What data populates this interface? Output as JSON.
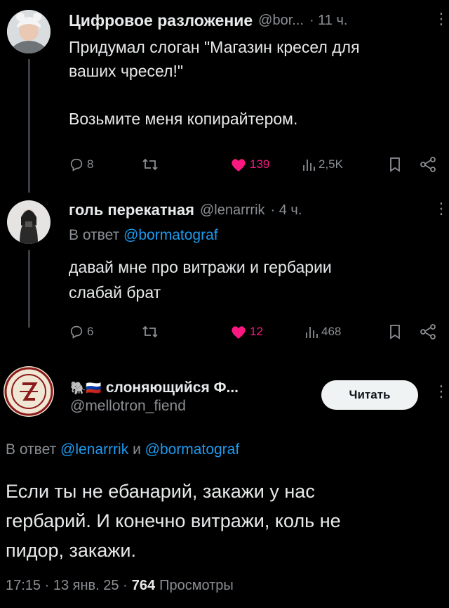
{
  "post1": {
    "display_name": "Цифровое разложение",
    "handle": "@bor...",
    "time": "· 11 ч.",
    "text_line1": "Придумал слоган \"Магазин кресел для",
    "text_line2": "ваших чресел!\"",
    "text_line3": "Возьмите меня копирайтером.",
    "replies": "8",
    "likes": "139",
    "views": "2,5K"
  },
  "post2": {
    "display_name": "голь перекатная",
    "handle": "@lenarrrik",
    "time": "· 4 ч.",
    "reply_prefix": "В ответ",
    "reply_to": "@bormatograf",
    "text_line1": "давай мне про витражи и гербарии",
    "text_line2": "слабай брат",
    "replies": "6",
    "likes": "12",
    "views": "468"
  },
  "post3": {
    "flag_emoji": "🐘🇷🇺",
    "display_name": "слоняющийся Ф...",
    "handle": "@mellotron_fiend",
    "follow_label": "Читать",
    "reply_prefix": "В ответ",
    "reply_to_1": "@lenarrrik",
    "reply_and": "и",
    "reply_to_2": "@bormatograf",
    "text_line1": "Если ты не ебанарий, закажи у нас",
    "text_line2": "гербарий. И конечно витражи, коль не",
    "text_line3": "пидор, закажи.",
    "timestamp": "17:15 · 13 янв. 25 ·",
    "views_count": "764",
    "views_label": "Просмотры"
  },
  "icons": {
    "reply": "reply-icon",
    "retweet": "retweet-icon",
    "like": "heart-icon",
    "views": "views-icon",
    "bookmark": "bookmark-icon",
    "share": "share-icon",
    "more": "more-icon"
  },
  "colors": {
    "background": "#000000",
    "text": "#e7e9ea",
    "muted": "#8b8f94",
    "link": "#1d9bf0",
    "like": "#f91880"
  }
}
